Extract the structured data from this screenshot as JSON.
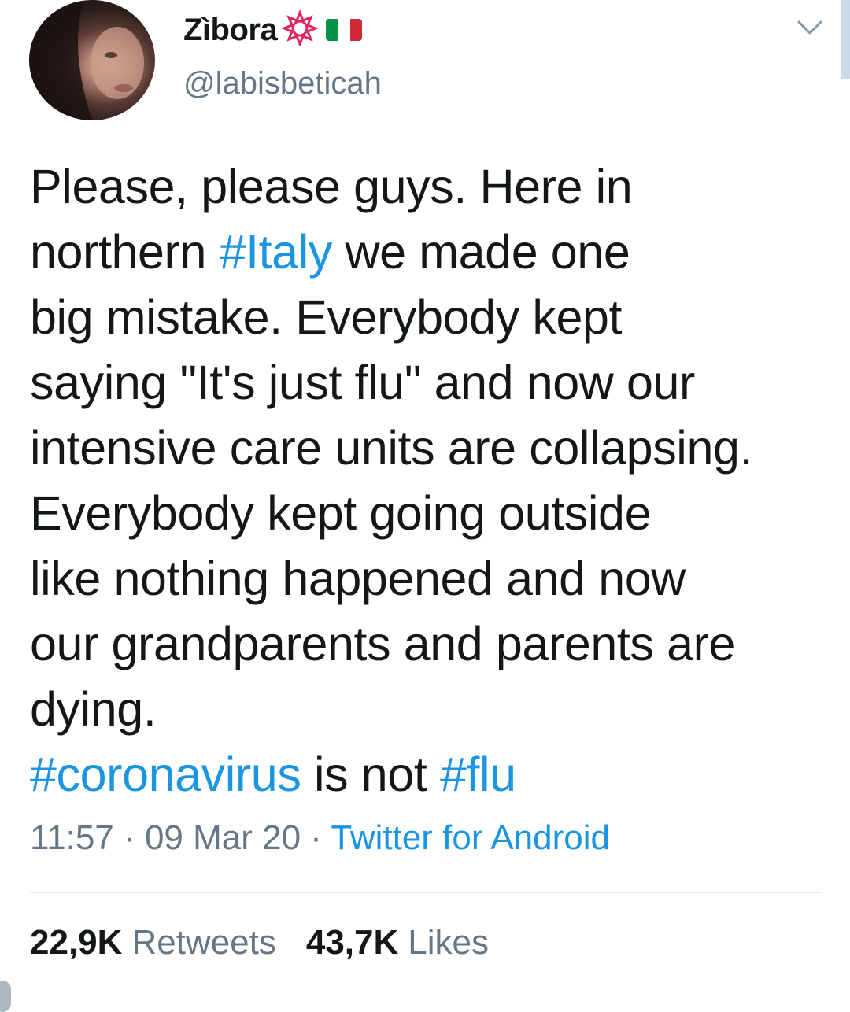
{
  "user": {
    "display_name": "Zìbora",
    "handle": "@labisbeticah",
    "badge_icon": "flower-badge-icon",
    "flag_icon": "italy-flag-icon",
    "flag_colors": [
      "#009246",
      "#ffffff",
      "#ce2b37"
    ]
  },
  "tweet": {
    "lines": [
      [
        "Please, please guys. Here in"
      ],
      [
        "northern ",
        "#Italy",
        " we made one"
      ],
      [
        "big mistake. Everybody kept"
      ],
      [
        "saying \"It's just flu\" and now our"
      ],
      [
        "intensive care units are collapsing."
      ],
      [
        "Everybody kept going outside"
      ],
      [
        "like nothing happened and now"
      ],
      [
        "our grandparents and parents are"
      ],
      [
        "dying."
      ],
      [
        "#coronavirus",
        " is not ",
        "#flu"
      ]
    ]
  },
  "meta": {
    "time": "11:57",
    "date": "09 Mar 20",
    "separator": " · ",
    "source": "Twitter for Android"
  },
  "stats": {
    "retweets_count": "22,9K",
    "retweets_label": "Retweets",
    "likes_count": "43,7K",
    "likes_label": "Likes"
  },
  "colors": {
    "link": "#1b95e0",
    "text": "#14171a",
    "secondary": "#657786"
  }
}
